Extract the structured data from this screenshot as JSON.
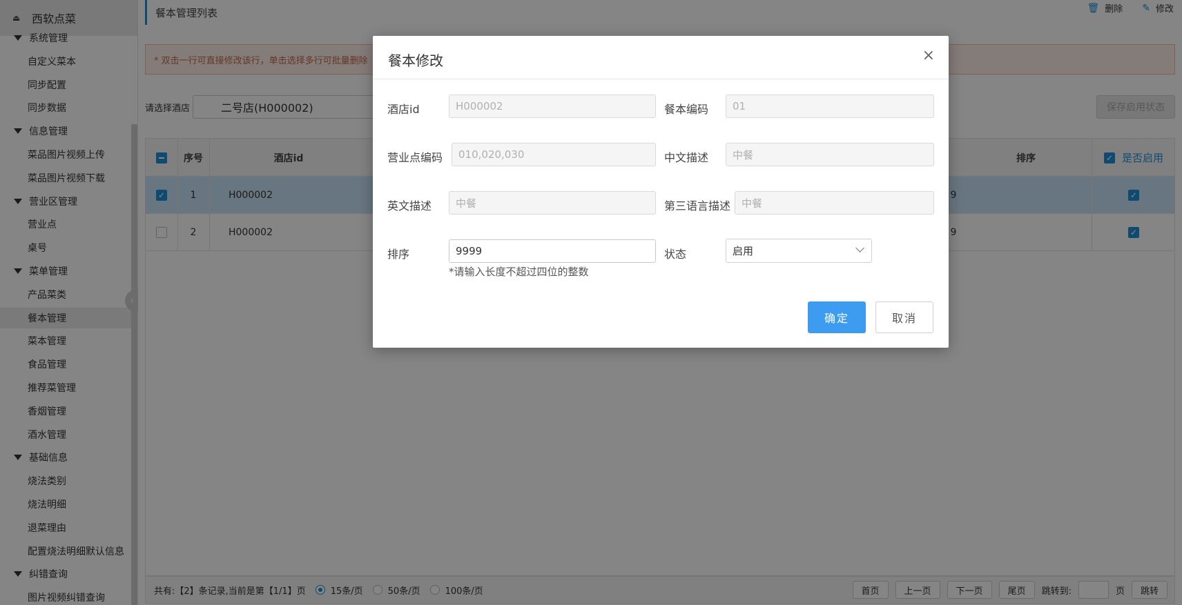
{
  "app": {
    "brand": "西软点菜"
  },
  "sidebar": {
    "items": [
      {
        "label": "系统管理",
        "type": "group"
      },
      {
        "label": "自定义菜本",
        "type": "child"
      },
      {
        "label": "同步配置",
        "type": "child"
      },
      {
        "label": "同步数据",
        "type": "child"
      },
      {
        "label": "信息管理",
        "type": "group"
      },
      {
        "label": "菜品图片视频上传",
        "type": "child"
      },
      {
        "label": "菜品图片视频下载",
        "type": "child"
      },
      {
        "label": "营业区管理",
        "type": "group"
      },
      {
        "label": "营业点",
        "type": "child"
      },
      {
        "label": "桌号",
        "type": "child"
      },
      {
        "label": "菜单管理",
        "type": "group"
      },
      {
        "label": "产品菜类",
        "type": "child"
      },
      {
        "label": "餐本管理",
        "type": "child",
        "active": true
      },
      {
        "label": "菜本管理",
        "type": "child"
      },
      {
        "label": "食品管理",
        "type": "child"
      },
      {
        "label": "推荐菜管理",
        "type": "child"
      },
      {
        "label": "香烟管理",
        "type": "child"
      },
      {
        "label": "酒水管理",
        "type": "child"
      },
      {
        "label": "基础信息",
        "type": "group"
      },
      {
        "label": "烧法类别",
        "type": "child"
      },
      {
        "label": "烧法明细",
        "type": "child"
      },
      {
        "label": "退菜理由",
        "type": "child"
      },
      {
        "label": "配置烧法明细默认信息",
        "type": "child"
      },
      {
        "label": "纠错查询",
        "type": "group"
      },
      {
        "label": "图片视频纠错查询",
        "type": "child"
      }
    ]
  },
  "page": {
    "title": "餐本管理列表",
    "actions": {
      "delete": "删除",
      "edit": "修改"
    },
    "notice": "* 双击一行可直接修改该行，单击选择多行可批量删除",
    "filter_label": "请选择酒店",
    "hotel_value": "二号店(H000002)",
    "save_status": "保存启用状态"
  },
  "grid": {
    "headers": {
      "seq": "序号",
      "hotel": "酒店id",
      "sort": "排序",
      "enabled": "是否启用"
    },
    "rows": [
      {
        "seq": "1",
        "hotel": "H000002",
        "sort": "9",
        "selected": true,
        "enabled": true
      },
      {
        "seq": "2",
        "hotel": "H000002",
        "sort": "9",
        "selected": false,
        "enabled": true
      }
    ]
  },
  "pager": {
    "info": "共有:【2】条记录,当前是第【1/1】页",
    "sizes": [
      "15条/页",
      "50条/页",
      "100条/页"
    ],
    "selected_size": "15条/页",
    "first": "首页",
    "prev": "上一页",
    "next": "下一页",
    "last": "尾页",
    "jump_label": "跳转到:",
    "page_unit": "页",
    "jump_btn": "跳转"
  },
  "modal": {
    "title": "餐本修改",
    "close": "×",
    "fields": {
      "hotel_id": {
        "label": "酒店id",
        "value": "H000002"
      },
      "menu_code": {
        "label": "餐本编码",
        "value": "01"
      },
      "outlet_code": {
        "label": "营业点编码",
        "value": "010,020,030"
      },
      "cn_desc": {
        "label": "中文描述",
        "placeholder": "中餐"
      },
      "en_desc": {
        "label": "英文描述",
        "placeholder": "中餐"
      },
      "third_desc": {
        "label": "第三语言描述",
        "placeholder": "中餐"
      },
      "sort": {
        "label": "排序",
        "value": "9999"
      },
      "status": {
        "label": "状态",
        "value": "启用"
      }
    },
    "hint": "*请输入长度不超过四位的整数",
    "ok": "确定",
    "cancel": "取消"
  },
  "colors": {
    "primary": "#3d9cf0",
    "accent_blue": "#1f8fd6",
    "selected_row": "#c8e3f7",
    "notice_bg": "#fdeee8"
  }
}
